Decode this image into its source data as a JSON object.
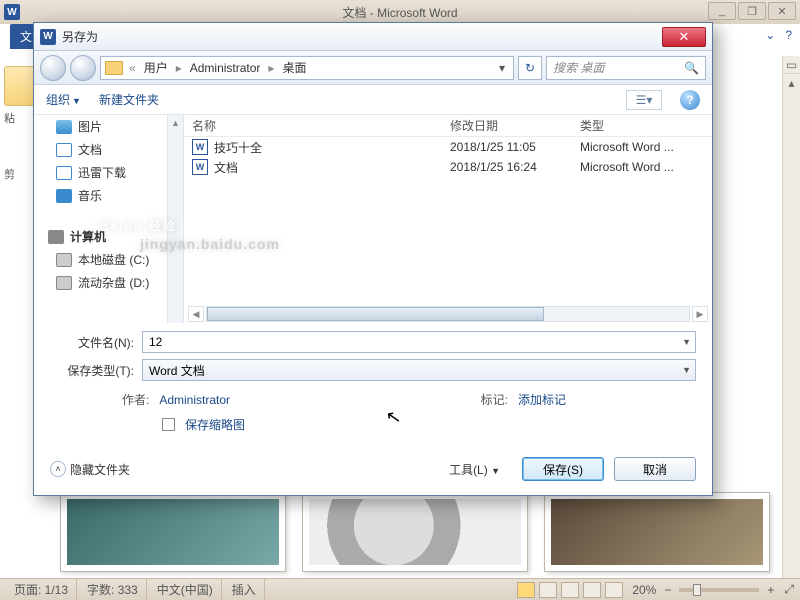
{
  "word": {
    "title": "文档 - Microsoft Word",
    "app_icon_letter": "W",
    "file_tab": "文",
    "clipboard_label": "粘",
    "scissors_label": "剪",
    "help_icons": {
      "dropdown": "⌄",
      "help": "?"
    },
    "status": {
      "page": "页面: 1/13",
      "words": "字数: 333",
      "lang": "中文(中国)",
      "mode": "插入",
      "zoom": "20%",
      "minus": "−",
      "plus": "+",
      "expand": "⤢"
    },
    "win_controls": {
      "min": "_",
      "max": "❐",
      "close": "✕"
    }
  },
  "dialog": {
    "title": "另存为",
    "icon_letter": "W",
    "close_glyph": "✕",
    "path": {
      "folder_glyph": "",
      "crumbs": [
        "用户",
        "Administrator",
        "桌面"
      ],
      "sep": "▸",
      "dd": "▾",
      "refresh": "↻"
    },
    "search_placeholder": "搜索 桌面",
    "search_icon": "🔍",
    "toolbar": {
      "organize": "组织",
      "newfolder": "新建文件夹",
      "view_glyph": "☰▾",
      "help_glyph": "?"
    },
    "sidebar": {
      "items_top": [
        {
          "label": "图片",
          "icon": "ico-pic"
        },
        {
          "label": "文档",
          "icon": "ico-doc"
        },
        {
          "label": "迅雷下载",
          "icon": "ico-dl"
        },
        {
          "label": "音乐",
          "icon": "ico-music"
        }
      ],
      "computer": "计算机",
      "drives": [
        {
          "label": "本地磁盘 (C:)",
          "icon": "ico-disk"
        },
        {
          "label": "流动杂盘 (D:)",
          "icon": "ico-disk"
        }
      ],
      "expand_glyph": "▴"
    },
    "columns": {
      "name": "名称",
      "date": "修改日期",
      "type": "类型"
    },
    "files": [
      {
        "name": "技巧十全",
        "date": "2018/1/25 11:05",
        "type": "Microsoft Word ..."
      },
      {
        "name": "文档",
        "date": "2018/1/25 16:24",
        "type": "Microsoft Word ..."
      }
    ],
    "filename_label": "文件名(N):",
    "filename_value": "12",
    "savetype_label": "保存类型(T):",
    "savetype_value": "Word 文档",
    "author_label": "作者:",
    "author_value": "Administrator",
    "tag_label": "标记:",
    "tag_value": "添加标记",
    "thumb_label": "保存缩略图",
    "hide_folders": "隐藏文件夹",
    "tools": "工具(L)",
    "save_btn": "保存(S)",
    "cancel_btn": "取消"
  },
  "watermark": {
    "main": "Baidu 经验",
    "sub": "jingyan.baidu.com"
  }
}
